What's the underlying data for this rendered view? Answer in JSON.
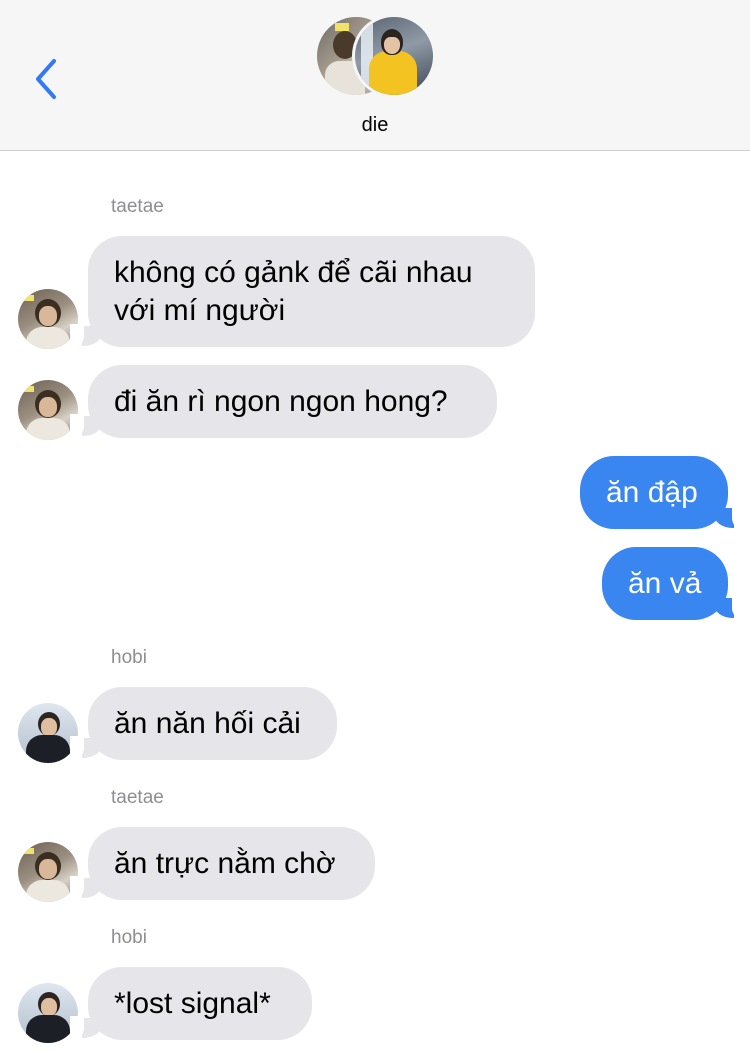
{
  "header": {
    "group_name": "die",
    "back_icon": "chevron-left-icon",
    "accent_color": "#3478f6"
  },
  "messages": [
    {
      "sender": "taetae",
      "text": "không có gảnk để cãi nhau\nvới mí người",
      "direction": "incoming"
    },
    {
      "sender": "taetae",
      "text": "đi ăn rì ngon ngon hong?",
      "direction": "incoming"
    },
    {
      "sender": "me",
      "text": "ăn đập",
      "direction": "outgoing"
    },
    {
      "sender": "me",
      "text": "ăn vả",
      "direction": "outgoing"
    },
    {
      "sender": "hobi",
      "text": "ăn năn hối cải",
      "direction": "incoming"
    },
    {
      "sender": "taetae",
      "text": "ăn trực nằm chờ",
      "direction": "incoming"
    },
    {
      "sender": "hobi",
      "text": "*lost signal*",
      "direction": "incoming"
    }
  ],
  "sender_labels": [
    "taetae",
    "hobi",
    "taetae",
    "hobi"
  ],
  "colors": {
    "incoming_bubble": "#e5e5ea",
    "outgoing_bubble": "#3a86f0",
    "sender_label": "#8e8e93"
  }
}
